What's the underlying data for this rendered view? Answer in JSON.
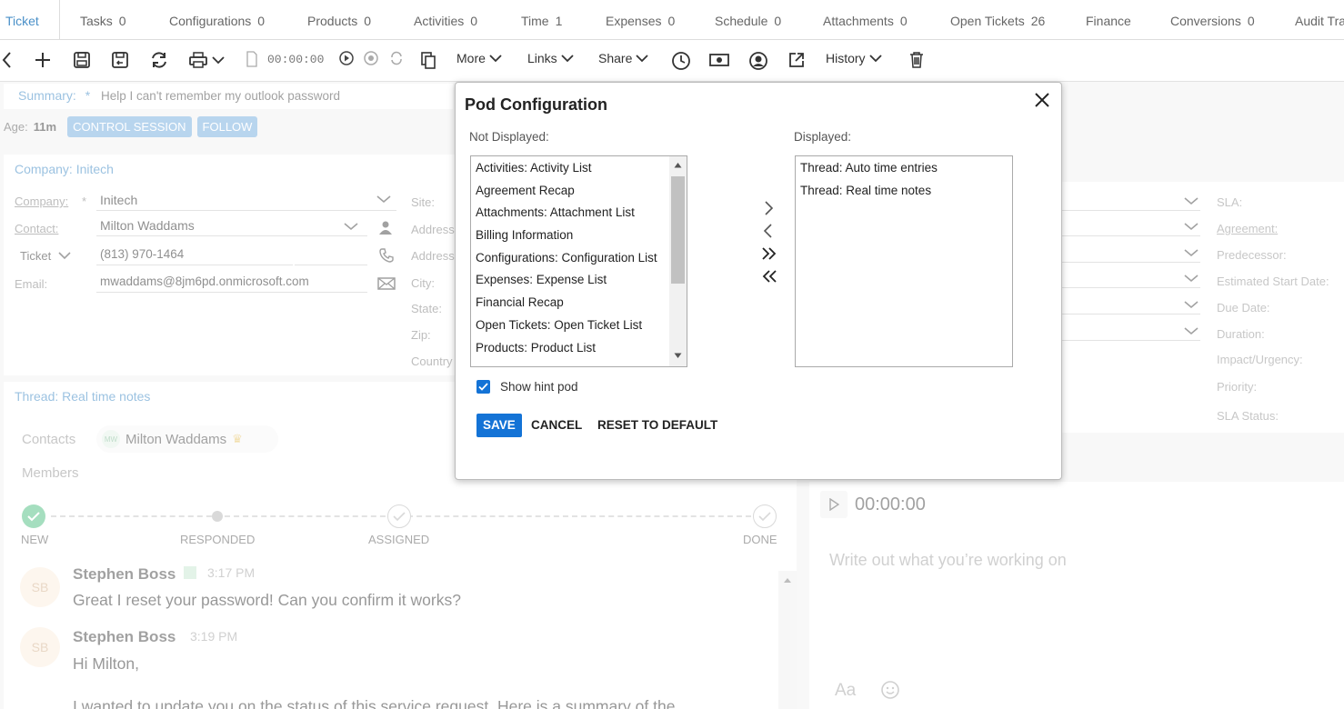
{
  "tabs": [
    {
      "label": "Ticket",
      "count": ""
    },
    {
      "label": "Tasks",
      "count": "0"
    },
    {
      "label": "Configurations",
      "count": "0"
    },
    {
      "label": "Products",
      "count": "0"
    },
    {
      "label": "Activities",
      "count": "0"
    },
    {
      "label": "Time",
      "count": "1"
    },
    {
      "label": "Expenses",
      "count": "0"
    },
    {
      "label": "Schedule",
      "count": "0"
    },
    {
      "label": "Attachments",
      "count": "0"
    },
    {
      "label": "Open Tickets",
      "count": "26"
    },
    {
      "label": "Finance",
      "count": ""
    },
    {
      "label": "Conversions",
      "count": "0"
    },
    {
      "label": "Audit Tra",
      "count": ""
    }
  ],
  "toolbar": {
    "timer": "00:00:00",
    "more": "More",
    "links": "Links",
    "share": "Share",
    "history": "History"
  },
  "summary": {
    "label": "Summary:",
    "required": "*",
    "value": "Help I can't remember my outlook password"
  },
  "age": {
    "label": "Age:",
    "value": "11m"
  },
  "pills": {
    "control": "CONTROL SESSION",
    "follow": "FOLLOW"
  },
  "company": {
    "title": "Company: Initech",
    "company_label": "Company:",
    "company_value": "Initech",
    "contact_label": "Contact:",
    "contact_value": "Milton Waddams",
    "phone_type": "Ticket",
    "phone_value": "(813) 970-1464",
    "email_label": "Email:",
    "email_value": "mwaddams@8jm6pd.onmicrosoft.com",
    "site_label": "Site:",
    "address1_label": "Address",
    "address2_label": "Address",
    "city_label": "City:",
    "state_label": "State:",
    "zip_label": "Zip:",
    "country_label": "Country"
  },
  "right_labels": {
    "sla": "SLA:",
    "agreement": "Agreement:",
    "predecessor": "Predecessor:",
    "est_start": "Estimated Start Date:",
    "due": "Due Date:",
    "duration": "Duration:",
    "impact": "Impact/Urgency:",
    "priority": "Priority:",
    "sla_status": "SLA Status:"
  },
  "thread": {
    "title": "Thread: Real time notes",
    "contacts_label": "Contacts",
    "contact_name": "Milton Waddams",
    "contact_initials": "MW",
    "members_label": "Members",
    "steps": [
      "NEW",
      "RESPONDED",
      "ASSIGNED",
      "DONE"
    ]
  },
  "messages": [
    {
      "initials": "SB",
      "author": "Stephen Boss",
      "time": "3:17 PM",
      "text": "Great I reset your password! Can you confirm it works?"
    },
    {
      "initials": "SB",
      "author": "Stephen Boss",
      "time": "3:19 PM",
      "text": "Hi Milton,"
    }
  ],
  "message_trailing": "I wanted to update you on the status of this service request. Here is a summary of the",
  "time_entry": {
    "timer": "00:00:00",
    "placeholder": "Write out what you’re working on",
    "font_btn": "Aa"
  },
  "modal": {
    "title": "Pod Configuration",
    "not_displayed_label": "Not Displayed:",
    "displayed_label": "Displayed:",
    "not_displayed": [
      "Activities: Activity List",
      "Agreement Recap",
      "Attachments: Attachment List",
      "Billing Information",
      "Configurations: Configuration List",
      "Expenses: Expense List",
      "Financial Recap",
      "Open Tickets: Open Ticket List",
      "Products: Product List"
    ],
    "displayed": [
      "Thread: Auto time entries",
      "Thread: Real time notes"
    ],
    "show_hint_label": "Show hint pod",
    "show_hint_checked": true,
    "save": "SAVE",
    "cancel": "CANCEL",
    "reset": "RESET TO DEFAULT"
  },
  "colors": {
    "accent": "#4a90c8",
    "primary_button": "#1473d6",
    "pill": "#7fb2e0",
    "check_green": "#5cc48a"
  }
}
